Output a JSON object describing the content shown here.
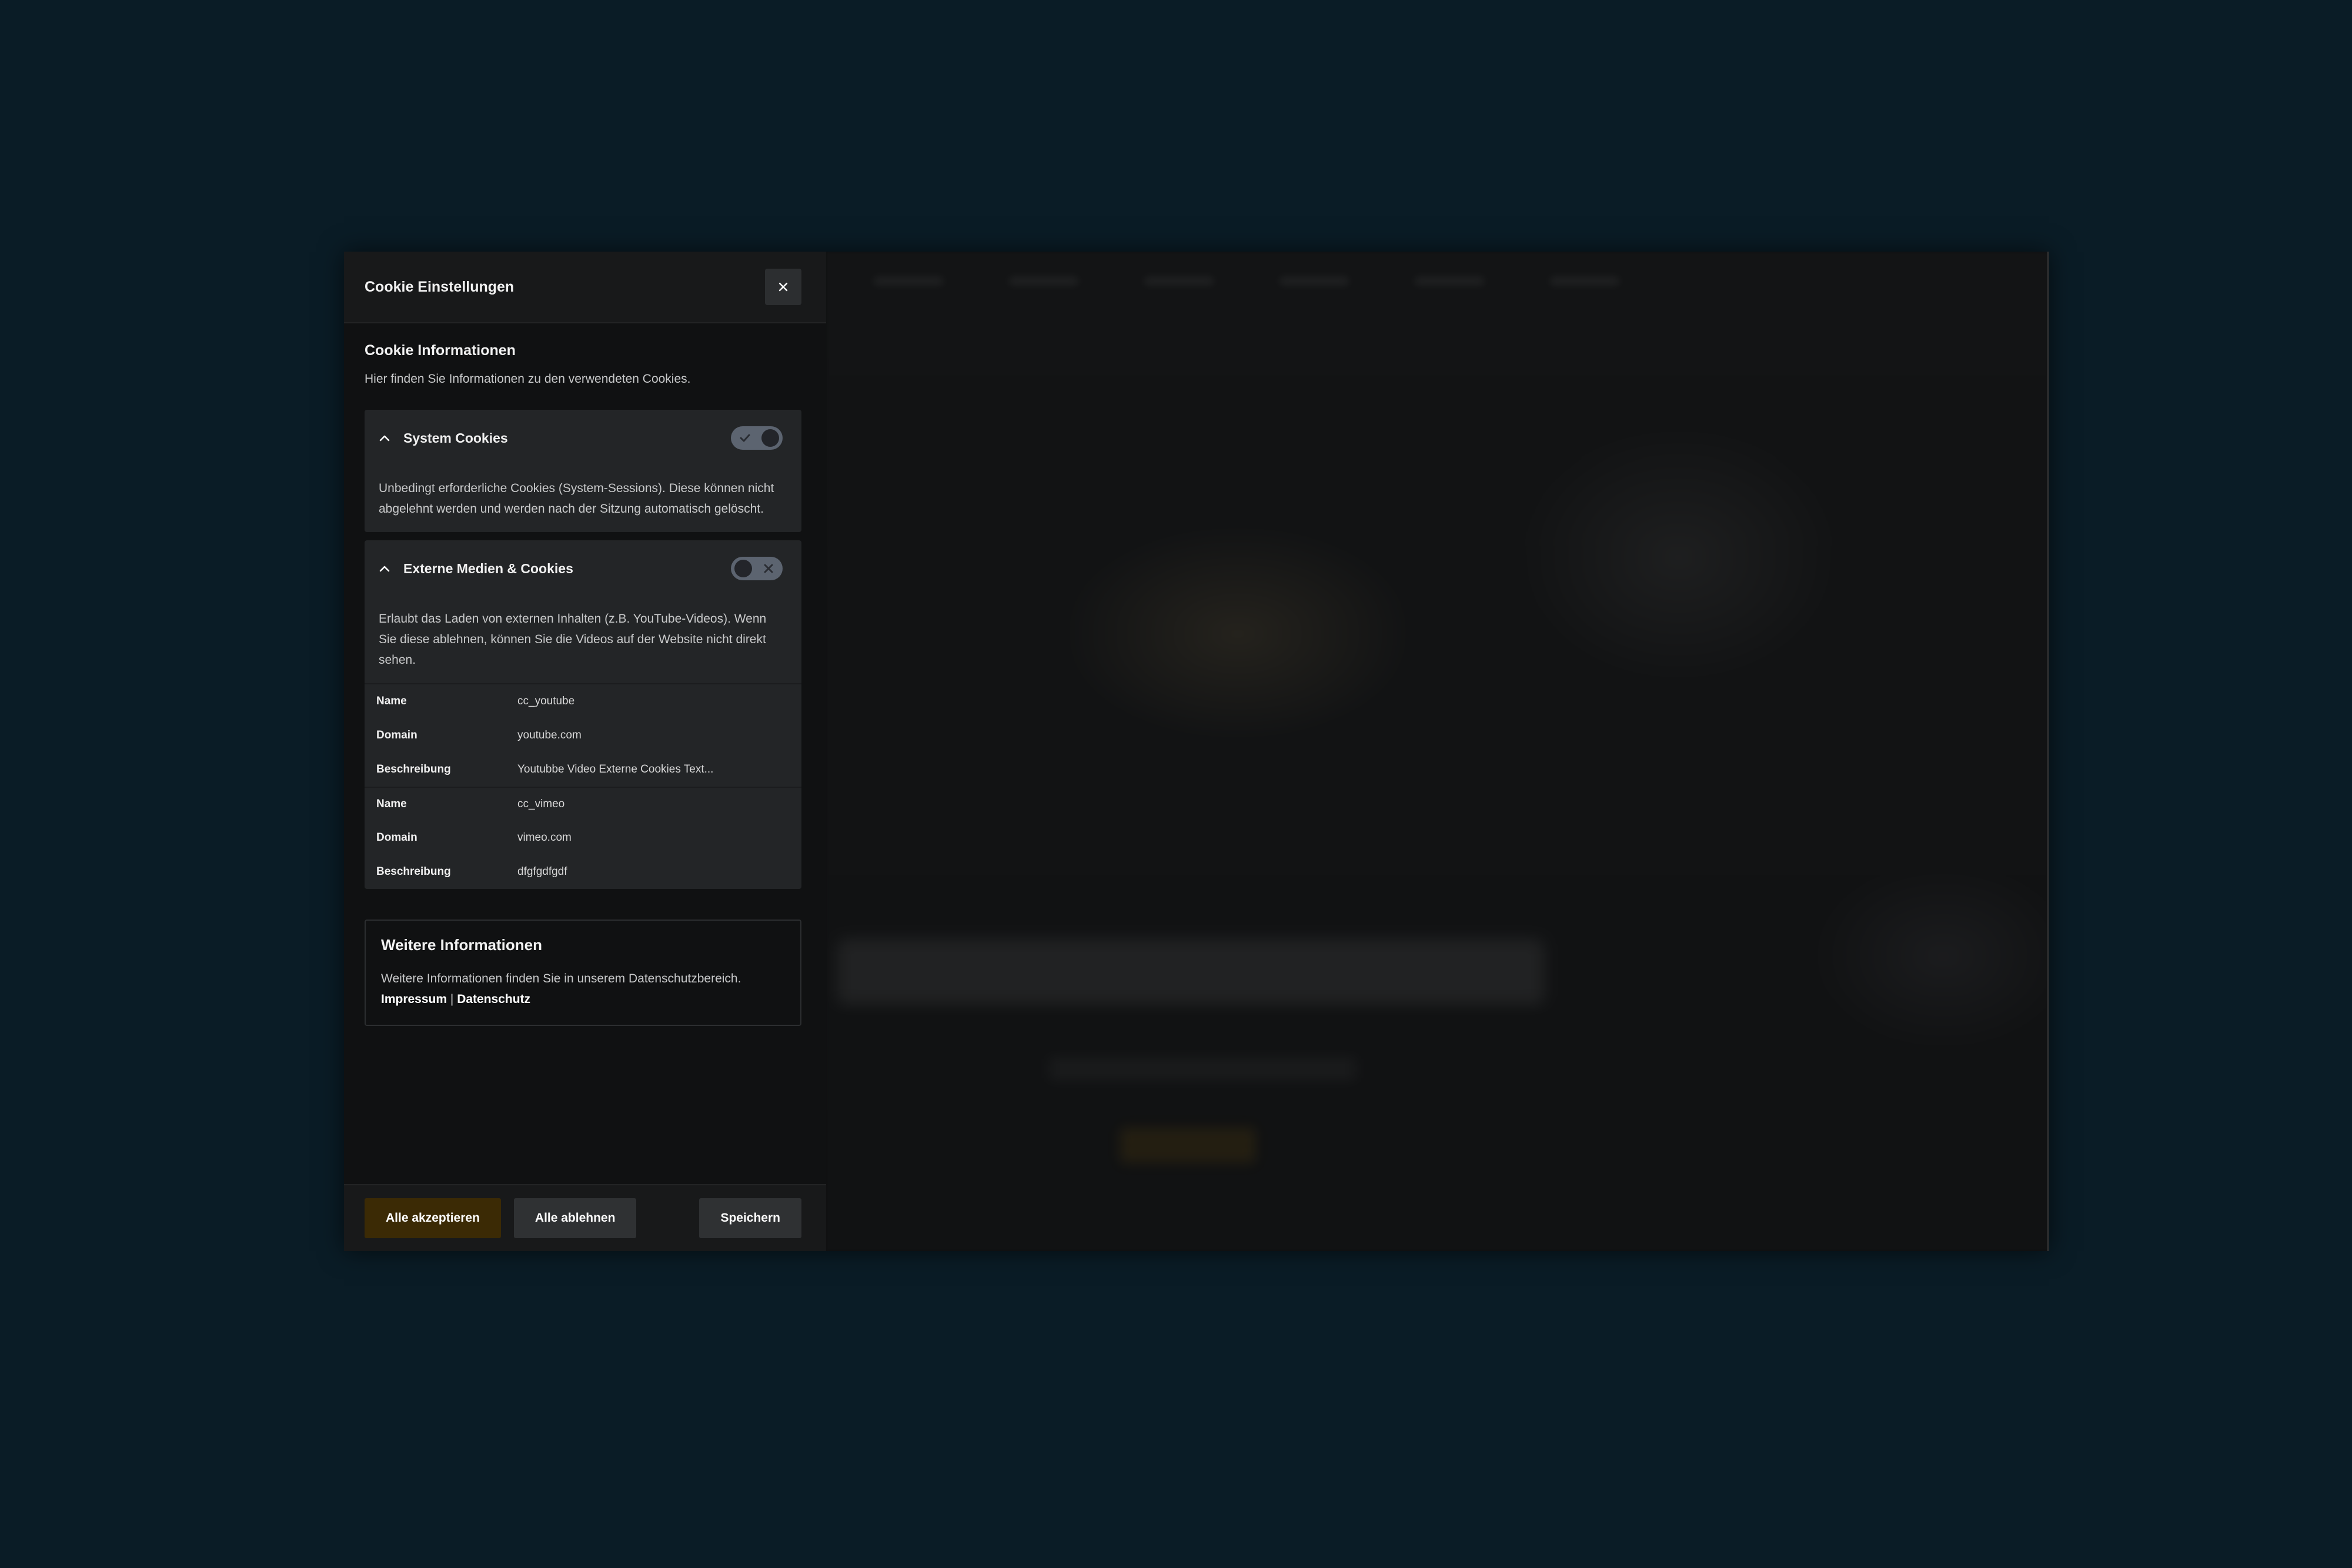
{
  "panel": {
    "title": "Cookie Einstellungen",
    "info_heading": "Cookie Informationen",
    "info_text": "Hier finden Sie Informationen zu den verwendeten Cookies."
  },
  "sections": [
    {
      "title": "System Cookies",
      "enabled": true,
      "description": "Unbedingt erforderliche Cookies (System-Sessions). Diese können nicht abgelehnt werden und werden nach der Sitzung automatisch gelöscht."
    },
    {
      "title": "Externe Medien & Cookies",
      "enabled": false,
      "description": "Erlaubt das Laden von externen Inhalten (z.B. YouTube-Videos). Wenn Sie diese ablehnen, können Sie die Videos auf der Website nicht direkt sehen.",
      "cookies": [
        {
          "name_label": "Name",
          "name": "cc_youtube",
          "domain_label": "Domain",
          "domain": "youtube.com",
          "desc_label": "Beschreibung",
          "desc": "Youtubbe Video Externe Cookies Text..."
        },
        {
          "name_label": "Name",
          "name": "cc_vimeo",
          "domain_label": "Domain",
          "domain": "vimeo.com",
          "desc_label": "Beschreibung",
          "desc": "dfgfgdfgdf"
        }
      ]
    }
  ],
  "further": {
    "heading": "Weitere Informationen",
    "text": "Weitere Informationen finden Sie in unserem Datenschutzbereich.",
    "link_impressum": "Impressum",
    "separator": "|",
    "link_datenschutz": "Datenschutz"
  },
  "footer": {
    "accept_all": "Alle akzeptieren",
    "reject_all": "Alle ablehnen",
    "save": "Speichern"
  },
  "colors": {
    "background": "#0a1c26",
    "panel": "#101112",
    "accept_button": "#3b2a05",
    "toggle_track": "#5c6470"
  }
}
